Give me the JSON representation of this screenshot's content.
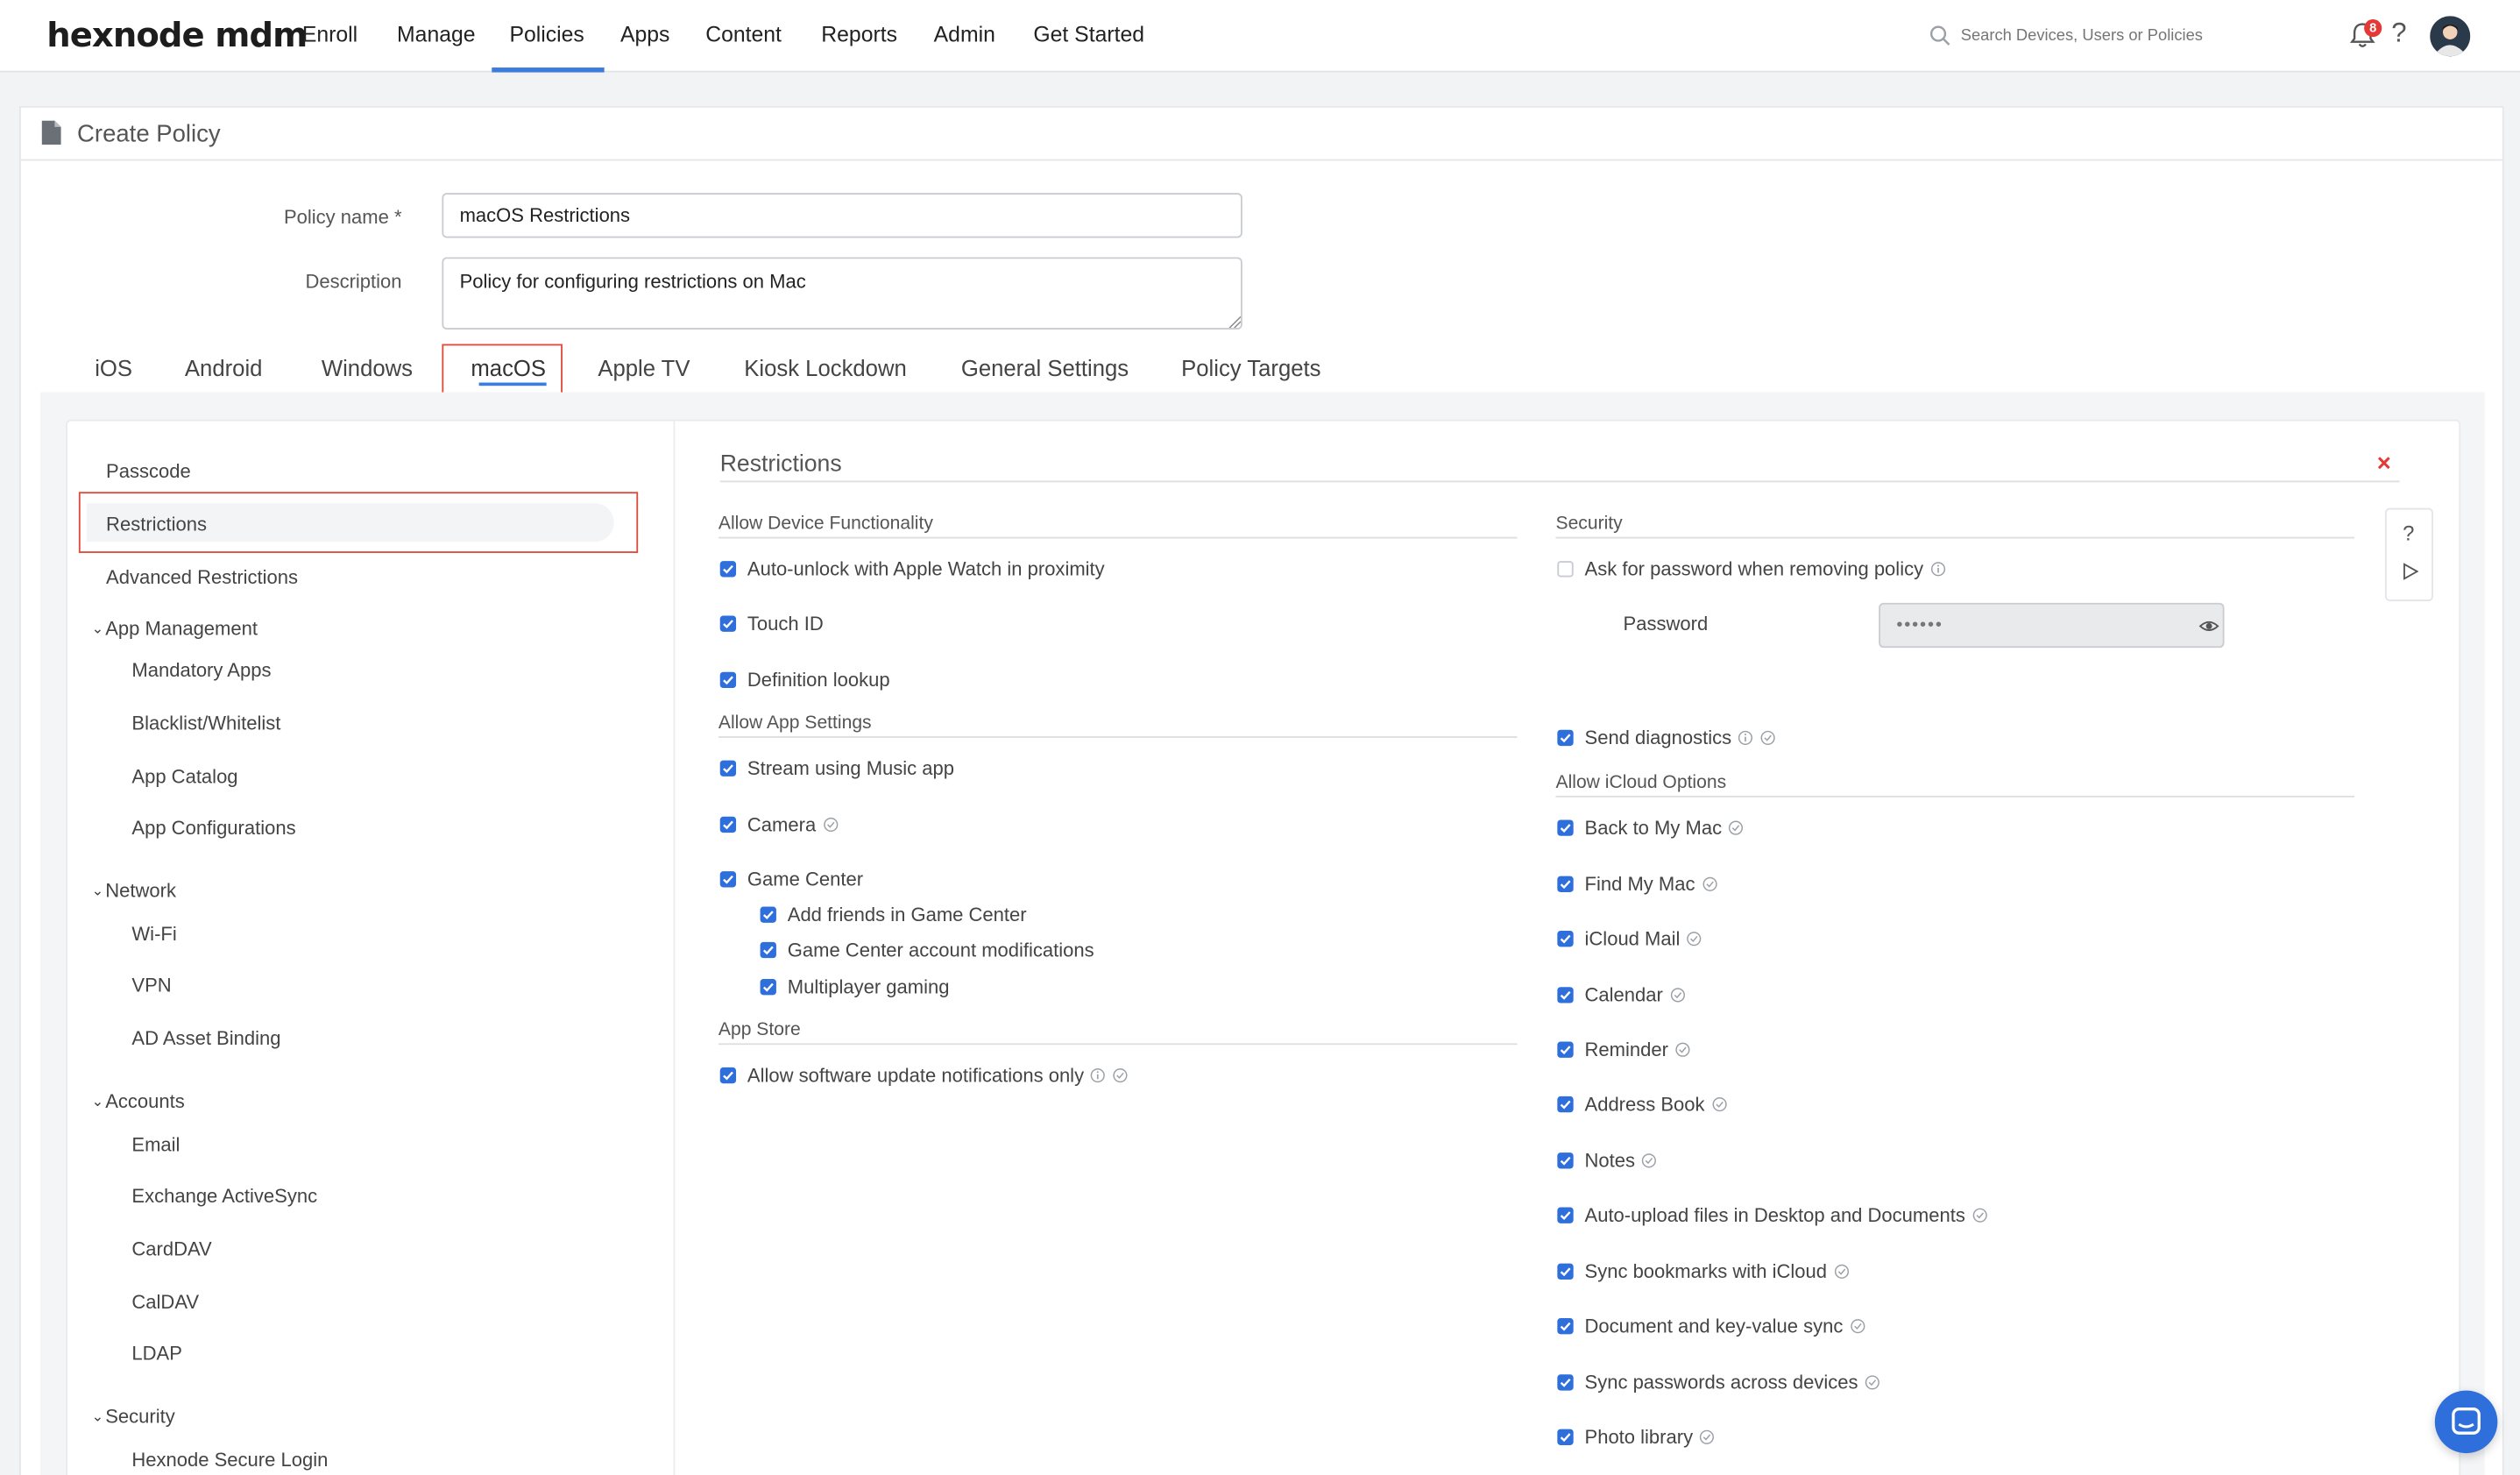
{
  "brand": {
    "logo": "hexnode mdm"
  },
  "nav": {
    "items": [
      "Enroll",
      "Manage",
      "Policies",
      "Apps",
      "Content",
      "Reports",
      "Admin",
      "Get Started"
    ],
    "active": "Policies",
    "search_placeholder": "Search Devices, Users or Policies",
    "notification_count": "8",
    "help": "?"
  },
  "page": {
    "title": "Create Policy"
  },
  "form": {
    "policy_name_label": "Policy name *",
    "policy_name_value": "macOS Restrictions",
    "description_label": "Description",
    "description_value": "Policy for configuring restrictions on Mac"
  },
  "tabs": {
    "items": [
      "iOS",
      "Android",
      "Windows",
      "macOS",
      "Apple TV",
      "Kiosk Lockdown",
      "General Settings",
      "Policy Targets"
    ],
    "active": "macOS"
  },
  "sidebar": {
    "passcode": "Passcode",
    "restrictions": "Restrictions",
    "advanced": "Advanced Restrictions",
    "app_management": {
      "label": "App Management",
      "items": [
        "Mandatory Apps",
        "Blacklist/Whitelist",
        "App Catalog",
        "App Configurations"
      ]
    },
    "network": {
      "label": "Network",
      "items": [
        "Wi-Fi",
        "VPN",
        "AD Asset Binding"
      ]
    },
    "accounts": {
      "label": "Accounts",
      "items": [
        "Email",
        "Exchange ActiveSync",
        "CardDAV",
        "CalDAV",
        "LDAP"
      ]
    },
    "security": {
      "label": "Security",
      "items": [
        "Hexnode Secure Login"
      ]
    }
  },
  "restrictions": {
    "title": "Restrictions",
    "close": "×",
    "device_functionality": {
      "title": "Allow Device Functionality",
      "items": [
        "Auto-unlock with Apple Watch in proximity",
        "Touch ID",
        "Definition lookup"
      ]
    },
    "app_settings": {
      "title": "Allow App Settings",
      "items": [
        "Stream using Music app",
        "Camera",
        "Game Center"
      ],
      "game_center_sub": [
        "Add friends in Game Center",
        "Game Center account modifications",
        "Multiplayer gaming"
      ]
    },
    "app_store": {
      "title": "App Store",
      "items": [
        "Allow software update notifications only"
      ]
    },
    "security": {
      "title": "Security",
      "ask_password": "Ask for password when removing policy",
      "password_label": "Password",
      "password_value": "••••••",
      "send_diagnostics": "Send diagnostics"
    },
    "icloud": {
      "title": "Allow iCloud Options",
      "items": [
        "Back to My Mac",
        "Find My Mac",
        "iCloud Mail",
        "Calendar",
        "Reminder",
        "Address Book",
        "Notes",
        "Auto-upload files in Desktop and Documents",
        "Sync bookmarks with iCloud",
        "Document and key-value sync",
        "Sync passwords across devices",
        "Photo library"
      ]
    },
    "tools": {
      "help": "?"
    }
  },
  "colors": {
    "accent": "#2f6fdb",
    "highlight": "#e04a3a",
    "close": "#e53935"
  }
}
